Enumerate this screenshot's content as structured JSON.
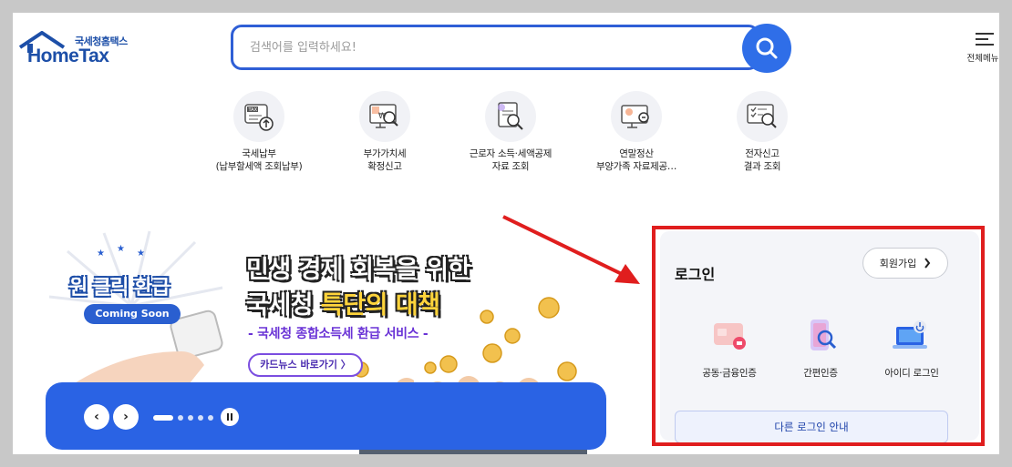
{
  "header": {
    "logo_sub": "국세청홈택스",
    "logo_main": "HomeTax",
    "search_placeholder": "검색어를 입력하세요!",
    "menu_label": "전체메뉴"
  },
  "quick_menu": [
    {
      "line1": "국세납부",
      "line2": "(납부할세액 조회납부)",
      "icon": "tax-payment-icon"
    },
    {
      "line1": "부가가치세",
      "line2": "확정신고",
      "icon": "vat-report-icon"
    },
    {
      "line1": "근로자 소득·세액공제",
      "line2": "자료 조회",
      "icon": "deduction-lookup-icon"
    },
    {
      "line1": "연말정산",
      "line2": "부양가족 자료제공…",
      "icon": "year-end-settlement-icon"
    },
    {
      "line1": "전자신고",
      "line2": "결과 조회",
      "icon": "e-filing-result-icon"
    }
  ],
  "banner": {
    "badge_title": "원 클릭 환급",
    "coming_soon": "Coming Soon",
    "headline1": "민생 경제 회복을 위한",
    "headline2_prefix": "국세청 ",
    "headline2_highlight": "특단의 대책",
    "subtitle": "- 국세청 종합소득세 환급 서비스 -",
    "cardnews_button": "카드뉴스 바로가기 〉",
    "prev_label": "‹",
    "next_label": "›"
  },
  "login": {
    "title": "로그인",
    "signup_label": "회원가입",
    "options": [
      {
        "label": "공동·금융인증",
        "icon": "certificate-card-icon"
      },
      {
        "label": "간편인증",
        "icon": "mobile-auth-icon"
      },
      {
        "label": "아이디 로그인",
        "icon": "id-login-icon"
      }
    ],
    "other_login": "다른 로그인 안내"
  },
  "colors": {
    "brand_blue": "#2f6ee8",
    "annotation_red": "#e01e1e",
    "banner_bar": "#2a63e4"
  }
}
